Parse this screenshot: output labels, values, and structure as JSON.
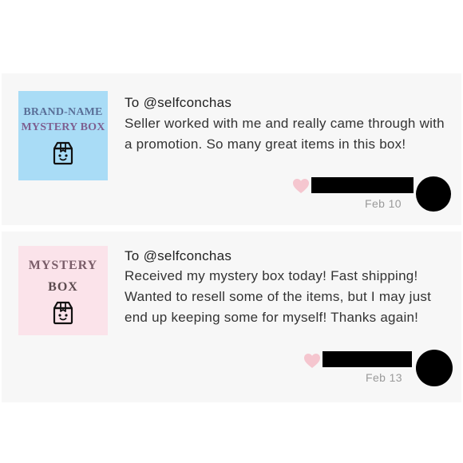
{
  "reviews": [
    {
      "thumbnail": {
        "line1": "BRAND-NAME",
        "line2": "MYSTERY BOX",
        "bg_color": "#a9dcf6",
        "icon": "mystery-box-icon"
      },
      "to_line": "To @selfconchas",
      "text": "Seller worked with me and really came through with a promotion. So many great items in this box!",
      "date": "Feb 10",
      "like_icon": "heart-icon"
    },
    {
      "thumbnail": {
        "line1": "MYSTERY",
        "line2": "BOX",
        "bg_color": "#fbe3ea",
        "icon": "mystery-box-icon"
      },
      "to_line": "To @selfconchas",
      "text": "Received my mystery box today! Fast shipping! Wanted to resell some of the items, but I may just end up keeping some for myself! Thanks again!",
      "date": "Feb 13",
      "like_icon": "heart-icon"
    }
  ],
  "colors": {
    "heart": "#f5c6cf",
    "date": "#9a9a9a",
    "panel_bg": "#f7f7f7"
  }
}
